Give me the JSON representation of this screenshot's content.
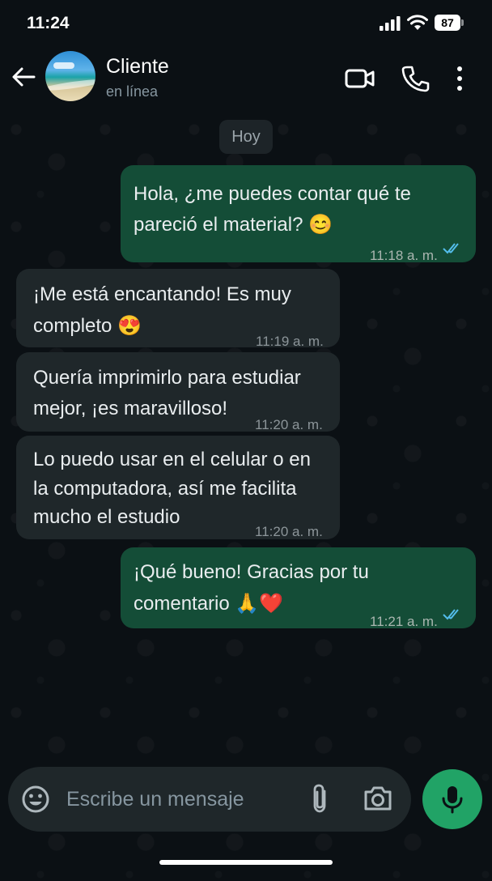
{
  "status_bar": {
    "time": "11:24",
    "battery": "87"
  },
  "header": {
    "contact_name": "Cliente",
    "contact_status": "en línea",
    "icons": [
      "back-arrow-icon",
      "video-call-icon",
      "phone-icon",
      "more-options-icon"
    ]
  },
  "chat": {
    "date_chip": "Hoy",
    "messages": [
      {
        "direction": "out",
        "lines": [
          "Hola, ¿me puedes contar qué te",
          "pareció el material? 😊"
        ],
        "time": "11:18 a. m.",
        "read": true
      },
      {
        "direction": "in",
        "lines": [
          "¡Me está encantando! Es muy",
          "completo 😍"
        ],
        "time": "11:19 a. m."
      },
      {
        "direction": "in",
        "lines": [
          "Quería imprimirlo para estudiar",
          "mejor, ¡es maravilloso!"
        ],
        "time": "11:20 a. m."
      },
      {
        "direction": "in",
        "lines": [
          "Lo puedo usar en el celular o en",
          "la computadora, así me facilita",
          "mucho el estudio"
        ],
        "time": "11:20 a. m."
      },
      {
        "direction": "out",
        "lines": [
          "¡Qué bueno! Gracias por tu",
          "comentario 🙏❤️"
        ],
        "time": "11:21 a. m.",
        "read": true
      }
    ]
  },
  "composer": {
    "placeholder": "Escribe un mensaje",
    "icons": [
      "emoji-icon",
      "attach-icon",
      "camera-icon",
      "mic-icon"
    ]
  },
  "colors": {
    "outgoing_bubble": "#144d37",
    "incoming_bubble": "#1f272a",
    "accent": "#21a366",
    "read_ticks": "#53bdeb"
  }
}
